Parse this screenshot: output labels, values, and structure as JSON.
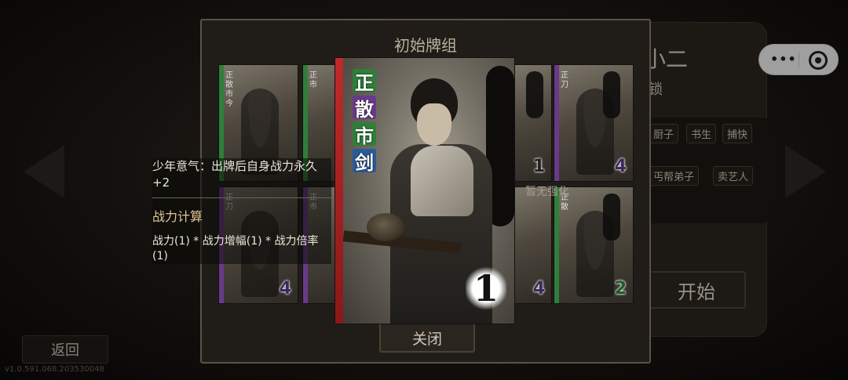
{
  "background": {
    "menu_title": "小二",
    "menu_sub": "锁",
    "tags": [
      "厨子",
      "书生",
      "捕快",
      "丐帮弟子",
      "卖艺人"
    ],
    "start_label": "开始",
    "back_label": "返回",
    "version": "v1.0.591.068.203530048"
  },
  "modal": {
    "title": "初始牌组",
    "close_label": "关闭",
    "no_enhance": "暂无强化",
    "info": {
      "description": "少年意气：出牌后自身战力永久+2",
      "calc_heading": "战力计算",
      "formula": "战力(1) * 战力增幅(1) * 战力倍率(1)"
    },
    "selected_card": {
      "tags": [
        {
          "char": "正",
          "color": "#2f7f3a"
        },
        {
          "char": "散",
          "color": "#6a3a8a"
        },
        {
          "char": "市",
          "color": "#2f7f3a"
        },
        {
          "char": "剑",
          "color": "#2a5a9a"
        }
      ],
      "cost": "1",
      "stripe_color": "#c02a2a"
    },
    "cards": [
      {
        "tags": "正散市今",
        "cost": "",
        "stripe": "#2f7f3a"
      },
      {
        "tags": "正市",
        "cost": "",
        "stripe": "#2f7f3a"
      },
      {
        "tags": "",
        "cost": "1",
        "stripe": "#3a3a3a"
      },
      {
        "tags": "正刀",
        "cost": "4",
        "stripe": "#6a3a8a"
      },
      {
        "tags": "正刀",
        "cost": "4",
        "stripe": "#6a3a8a"
      },
      {
        "tags": "正市",
        "cost": "",
        "stripe": "#6a3a8a"
      },
      {
        "tags": "",
        "cost": "4",
        "stripe": "#6a3a8a"
      },
      {
        "tags": "正散",
        "cost": "2",
        "stripe": "#2f7f3a"
      }
    ]
  }
}
